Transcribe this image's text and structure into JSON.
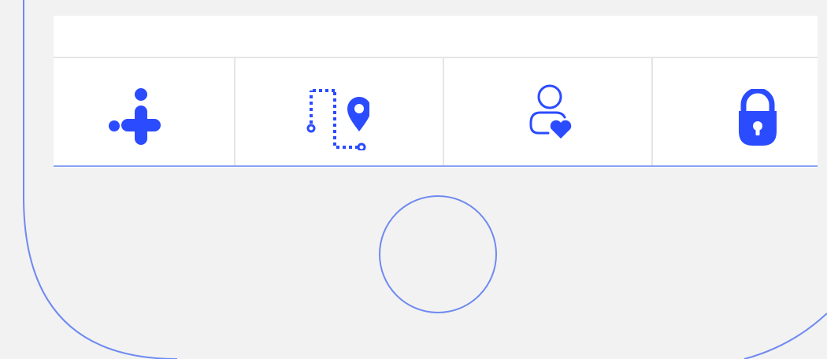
{
  "device": {
    "outline_color": "#6f8af0"
  },
  "tab_bar": {
    "accent": "#2b4bff",
    "items": [
      {
        "icon": "add-dots-icon"
      },
      {
        "icon": "route-pin-icon"
      },
      {
        "icon": "user-heart-icon"
      },
      {
        "icon": "lock-icon"
      }
    ]
  }
}
